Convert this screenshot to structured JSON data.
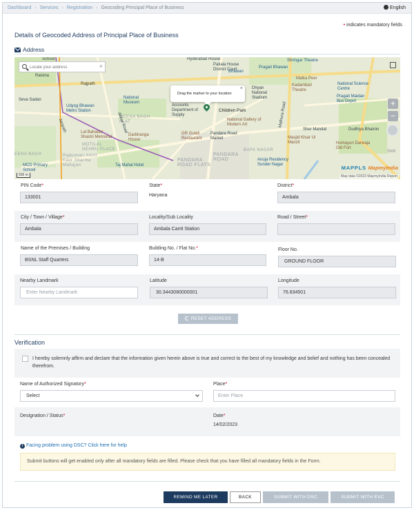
{
  "breadcrumb": {
    "items": [
      "Dashboard",
      "Services",
      "Registration"
    ],
    "current": "Geocoding Principal Place of Business"
  },
  "language": "English",
  "mandatory_note": "indicates mandatory fields",
  "page_title": "Details of Geocoded Address of Principal Place of Business",
  "address_heading": "Address",
  "map": {
    "search_placeholder": "Locate your address",
    "tooltip": "Drag the marker to your location",
    "brand": "MAPPLS",
    "brand_suffix": "MapmyIndia",
    "attribution": "Map data ©2023 MapmyIndia Report",
    "scale": "500 m",
    "labels": {
      "hyderabad_house": "Hyderabad House",
      "patiala_house": "Patiala House District Court",
      "shringar": "Shringar Theatre",
      "pragati_bhawan": "Pragati Bhawan",
      "matka_peer": "Matka Peer",
      "kadambari": "Kadambari Theatre",
      "nsc": "National Science Centre",
      "pragati_maidan": "Pragati Maidan Bus Depot",
      "rajpath": "Rajpath",
      "seva_sadan": "Seva Sadan",
      "udyog": "Udyog Bhawan Metro Station",
      "national_museum": "National Museum",
      "meena_bagh": "MEENA BAGH FLAT",
      "accounts": "Accounts Department of Supply",
      "children_park": "Children Park",
      "dhyan": "Dhyan National Stadium",
      "lbs": "Lal Bahadur Shastri Memorial",
      "darbhanga": "Darbhanga House",
      "motilal": "MOTILAL NEHRU PLACE",
      "gr_gulati": "GR Gulati Restaurant",
      "pandara_road": "Pandara Road Market",
      "ngma": "National Gallery of Modern Art",
      "sher_mandal": "Sher Mandal",
      "dudhiya": "Dudhiya Bhairon",
      "khair": "Masjid Khair Ul Manzil",
      "humayun": "Humayun Darwaja Old Fort",
      "bapa_nagar": "BAPA NAGAR",
      "pandara_flats": "PANDARA ROAD FLATS",
      "pandara_2": "PANDARA ROAD",
      "anuja": "Anuja Residency Sunder Nagar",
      "taj": "Taj Mahal Hotel",
      "rajkumari": "Rajkumari Amrit Kaur Sharma Mahajan",
      "janpath": "Janpath",
      "mcd": "MCD Primary School",
      "meena_bagh2": "EENA BAGH",
      "akbar": "Akbar Road",
      "mathura": "Mathura Road",
      "school": "School",
      "raisina": "Raisina",
      "bhawan_kp": "Bhawan",
      "smit": "Smit"
    }
  },
  "fields": {
    "pin_label": "PIN Code",
    "pin_value": "133001",
    "state_label": "State",
    "state_value": "Haryana",
    "district_label": "District",
    "district_value": "Ambala",
    "city_label": "City / Town / Village",
    "city_value": "Ambala",
    "locality_label": "Locality/Sub Locality",
    "locality_value": "Ambala Cantt Station",
    "road_label": "Road / Street",
    "road_value": "",
    "premises_label": "Name of the Premises / Building",
    "premises_value": "BSNL Staff Quarters",
    "building_label": "Building No. / Flat No.",
    "building_value": "14-B",
    "floor_label": "Floor No.",
    "floor_value": "GROUND FLOOR",
    "landmark_label": "Nearby Landmark",
    "landmark_placeholder": "Enter Nearby Landmark",
    "latitude_label": "Latitude",
    "latitude_value": "30.3443080000001",
    "longitude_label": "Longitude",
    "longitude_value": "76.834501"
  },
  "reset_button": "RESET ADDRESS",
  "verification": {
    "title": "Verification",
    "declaration": "I hereby solemnly affirm and declare that the information given herein above is true and correct to the best of my knowledge and belief and nothing has been concealed therefrom.",
    "signatory_label": "Name of Authorized Signatory",
    "signatory_value": "Select",
    "place_label": "Place",
    "place_placeholder": "Enter Place",
    "designation_label": "Designation / Status",
    "date_label": "Date",
    "date_value": "14/02/2023"
  },
  "help_link": "Facing problem using DSC? Click here for help",
  "notice": "Submit buttons will get enabled only after all mandatory fields are filled. Please check that you have filled all mandatory fields in the Form.",
  "buttons": {
    "remind": "REMIND ME LATER",
    "back": "BACK",
    "dsc": "SUBMIT WITH DSC",
    "evc": "SUBMIT WITH EVC"
  },
  "colors": {
    "navy": "#1d3a5f",
    "required": "#d0021b",
    "disabled_button": "#b6c1cc",
    "band_bg": "#f1f3f5",
    "notice_bg": "#fcf8e3"
  }
}
